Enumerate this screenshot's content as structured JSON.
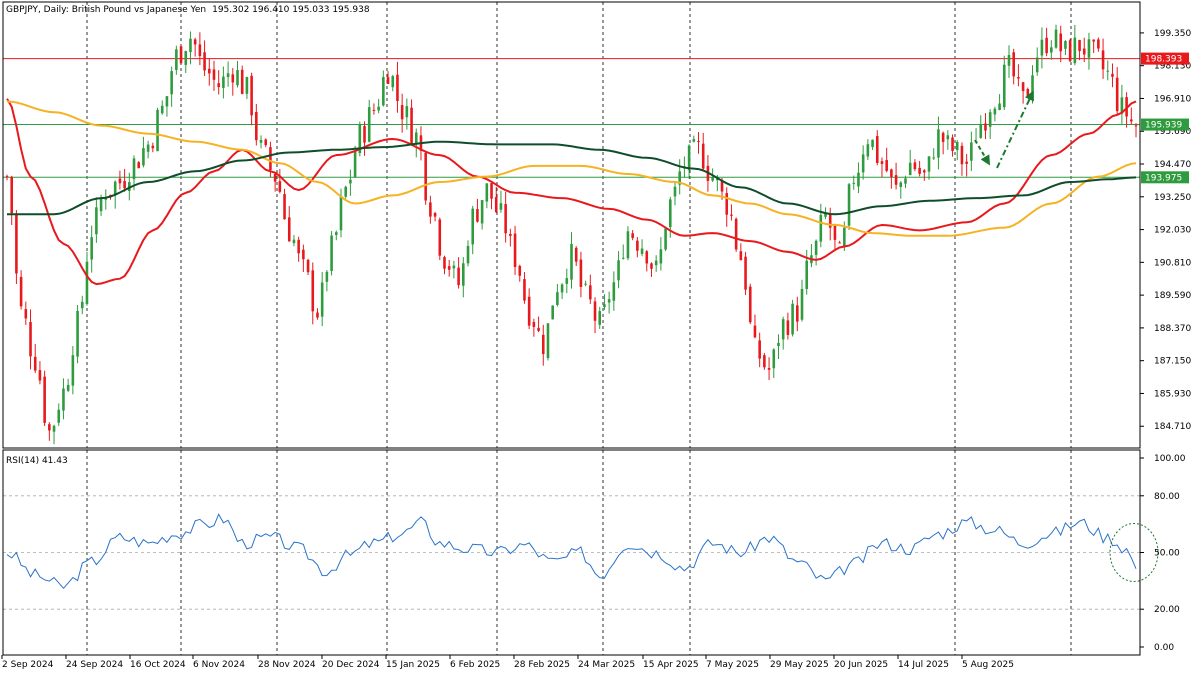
{
  "chart_data": {
    "type": "candlestick",
    "title": "GBPJPY, Daily:  British Pound vs Japanese Yen",
    "ohlc": "195.302 196.410 195.033 195.938",
    "price_axis": {
      "ylim": [
        183.9,
        200.5
      ],
      "ticks": [
        "199.350",
        "198.130",
        "196.910",
        "195.690",
        "194.470",
        "193.250",
        "192.030",
        "190.810",
        "189.590",
        "188.370",
        "187.150",
        "185.930",
        "184.710"
      ]
    },
    "x_ticks": [
      "2 Sep 2024",
      "24 Sep 2024",
      "16 Oct 2024",
      "6 Nov 2024",
      "28 Nov 2024",
      "20 Dec 2024",
      "15 Jan 2025",
      "6 Feb 2025",
      "28 Feb 2025",
      "24 Mar 2025",
      "15 Apr 2025",
      "7 May 2025",
      "29 May 2025",
      "20 Jun 2025",
      "14 Jul 2025",
      "5 Aug 2025"
    ],
    "price_tags": [
      {
        "value": "198.393",
        "color": "#e8191d"
      },
      {
        "value": "195.939",
        "color": "#2e9b3e"
      },
      {
        "value": "193.975",
        "color": "#2e9b3e"
      }
    ],
    "horizontal_levels": [
      {
        "value": 198.393,
        "color": "#e8191d"
      },
      {
        "value": 195.939,
        "color": "#2e9b3e"
      },
      {
        "value": 193.975,
        "color": "#2e9b3e"
      }
    ],
    "close_anchors": [
      [
        0,
        194.0
      ],
      [
        3,
        189.0
      ],
      [
        6,
        187.2
      ],
      [
        9,
        184.5
      ],
      [
        12,
        186.0
      ],
      [
        15,
        188.5
      ],
      [
        18,
        192.0
      ],
      [
        21,
        193.5
      ],
      [
        24,
        193.8
      ],
      [
        27,
        194.5
      ],
      [
        30,
        195.2
      ],
      [
        33,
        196.5
      ],
      [
        36,
        198.5
      ],
      [
        39,
        199.2
      ],
      [
        42,
        198.0
      ],
      [
        45,
        197.4
      ],
      [
        48,
        198.0
      ],
      [
        51,
        197.2
      ],
      [
        54,
        195.0
      ],
      [
        57,
        194.0
      ],
      [
        60,
        192.0
      ],
      [
        63,
        190.5
      ],
      [
        66,
        189.0
      ],
      [
        69,
        191.3
      ],
      [
        72,
        193.5
      ],
      [
        75,
        195.5
      ],
      [
        78,
        196.5
      ],
      [
        81,
        198.0
      ],
      [
        84,
        196.5
      ],
      [
        87,
        195.5
      ],
      [
        90,
        193.0
      ],
      [
        93,
        191.0
      ],
      [
        96,
        190.0
      ],
      [
        99,
        192.5
      ],
      [
        102,
        193.5
      ],
      [
        105,
        192.5
      ],
      [
        108,
        191.0
      ],
      [
        111,
        189.0
      ],
      [
        114,
        187.8
      ],
      [
        117,
        190.0
      ],
      [
        120,
        191.0
      ],
      [
        123,
        189.5
      ],
      [
        126,
        188.5
      ],
      [
        129,
        190.0
      ],
      [
        132,
        192.0
      ],
      [
        135,
        191.5
      ],
      [
        138,
        190.5
      ],
      [
        141,
        193.0
      ],
      [
        144,
        194.5
      ],
      [
        147,
        195.0
      ],
      [
        150,
        194.0
      ],
      [
        153,
        193.0
      ],
      [
        156,
        191.0
      ],
      [
        159,
        187.5
      ],
      [
        162,
        186.8
      ],
      [
        165,
        188.5
      ],
      [
        168,
        189.0
      ],
      [
        171,
        191.0
      ],
      [
        174,
        192.5
      ],
      [
        177,
        191.0
      ],
      [
        180,
        194.0
      ],
      [
        183,
        195.5
      ],
      [
        186,
        194.5
      ],
      [
        189,
        193.5
      ],
      [
        192,
        194.5
      ],
      [
        195,
        194.0
      ],
      [
        198,
        195.5
      ],
      [
        201,
        195.0
      ],
      [
        204,
        194.5
      ],
      [
        207,
        196.0
      ],
      [
        210,
        197.0
      ],
      [
        213,
        198.0
      ],
      [
        216,
        196.8
      ],
      [
        219,
        198.6
      ],
      [
        222,
        199.2
      ],
      [
        225,
        198.6
      ],
      [
        228,
        198.9
      ],
      [
        231,
        198.5
      ],
      [
        234,
        197.8
      ],
      [
        237,
        196.5
      ],
      [
        240,
        195.9
      ]
    ],
    "series": [
      {
        "color": "#e8191d",
        "anchors": [
          [
            0,
            196.9
          ],
          [
            5,
            194.0
          ],
          [
            12,
            191.5
          ],
          [
            19,
            190.0
          ],
          [
            24,
            190.2
          ],
          [
            31,
            192.0
          ],
          [
            38,
            193.4
          ],
          [
            44,
            194.2
          ],
          [
            50,
            195.0
          ],
          [
            56,
            194.2
          ],
          [
            62,
            193.5
          ],
          [
            70,
            194.8
          ],
          [
            82,
            195.4
          ],
          [
            92,
            194.8
          ],
          [
            100,
            194.0
          ],
          [
            108,
            193.4
          ],
          [
            118,
            193.2
          ],
          [
            128,
            192.8
          ],
          [
            136,
            192.4
          ],
          [
            144,
            191.8
          ],
          [
            150,
            191.9
          ],
          [
            158,
            191.6
          ],
          [
            166,
            191.2
          ],
          [
            172,
            190.9
          ],
          [
            178,
            191.4
          ],
          [
            186,
            192.2
          ],
          [
            194,
            192.0
          ],
          [
            204,
            192.3
          ],
          [
            212,
            193.0
          ],
          [
            222,
            194.8
          ],
          [
            230,
            195.6
          ],
          [
            236,
            196.3
          ],
          [
            240,
            196.8
          ]
        ]
      },
      {
        "color": "#f5b324",
        "anchors": [
          [
            0,
            196.8
          ],
          [
            10,
            196.4
          ],
          [
            20,
            195.9
          ],
          [
            30,
            195.6
          ],
          [
            40,
            195.3
          ],
          [
            50,
            195.0
          ],
          [
            58,
            194.5
          ],
          [
            66,
            193.8
          ],
          [
            74,
            193.0
          ],
          [
            82,
            193.3
          ],
          [
            92,
            193.8
          ],
          [
            102,
            194.0
          ],
          [
            112,
            194.4
          ],
          [
            122,
            194.4
          ],
          [
            132,
            194.1
          ],
          [
            142,
            193.8
          ],
          [
            150,
            193.3
          ],
          [
            158,
            193.0
          ],
          [
            166,
            192.6
          ],
          [
            176,
            192.2
          ],
          [
            184,
            191.9
          ],
          [
            192,
            191.8
          ],
          [
            200,
            191.8
          ],
          [
            212,
            192.1
          ],
          [
            222,
            193.0
          ],
          [
            232,
            194.0
          ],
          [
            240,
            194.5
          ]
        ]
      },
      {
        "color": "#0f4e2a",
        "anchors": [
          [
            0,
            192.6
          ],
          [
            10,
            192.6
          ],
          [
            20,
            193.2
          ],
          [
            30,
            193.8
          ],
          [
            40,
            194.2
          ],
          [
            50,
            194.6
          ],
          [
            60,
            194.9
          ],
          [
            70,
            195.0
          ],
          [
            80,
            195.1
          ],
          [
            92,
            195.3
          ],
          [
            104,
            195.2
          ],
          [
            116,
            195.2
          ],
          [
            126,
            195.0
          ],
          [
            136,
            194.7
          ],
          [
            146,
            194.3
          ],
          [
            156,
            193.6
          ],
          [
            166,
            193.0
          ],
          [
            176,
            192.6
          ],
          [
            186,
            192.9
          ],
          [
            196,
            193.1
          ],
          [
            206,
            193.2
          ],
          [
            216,
            193.3
          ],
          [
            226,
            193.8
          ],
          [
            234,
            193.9
          ],
          [
            240,
            193.97
          ]
        ]
      }
    ],
    "annotation": {
      "type": "arrows",
      "color": "#1b7a2f"
    },
    "rsi": {
      "title": "RSI(14) 41.43",
      "ylim": [
        0,
        100
      ],
      "ticks": [
        "100.00",
        "80.00",
        "50.00",
        "20.00",
        "0.00"
      ],
      "levels": [
        80,
        50,
        20
      ],
      "color": "#2a73c9",
      "anchors": [
        [
          0,
          50
        ],
        [
          6,
          38
        ],
        [
          12,
          32
        ],
        [
          18,
          45
        ],
        [
          24,
          58
        ],
        [
          30,
          55
        ],
        [
          36,
          60
        ],
        [
          42,
          65
        ],
        [
          46,
          68
        ],
        [
          50,
          55
        ],
        [
          56,
          58
        ],
        [
          62,
          52
        ],
        [
          68,
          40
        ],
        [
          72,
          48
        ],
        [
          78,
          55
        ],
        [
          84,
          60
        ],
        [
          88,
          66
        ],
        [
          92,
          55
        ],
        [
          98,
          52
        ],
        [
          104,
          50
        ],
        [
          110,
          54
        ],
        [
          116,
          45
        ],
        [
          122,
          50
        ],
        [
          126,
          38
        ],
        [
          132,
          55
        ],
        [
          138,
          50
        ],
        [
          144,
          42
        ],
        [
          150,
          55
        ],
        [
          156,
          50
        ],
        [
          162,
          58
        ],
        [
          168,
          45
        ],
        [
          174,
          35
        ],
        [
          180,
          44
        ],
        [
          186,
          55
        ],
        [
          192,
          52
        ],
        [
          198,
          60
        ],
        [
          204,
          66
        ],
        [
          210,
          62
        ],
        [
          216,
          55
        ],
        [
          222,
          60
        ],
        [
          228,
          66
        ],
        [
          234,
          58
        ],
        [
          238,
          52
        ],
        [
          240,
          41.43
        ]
      ],
      "circle": {
        "x_index": 240,
        "value": 50
      }
    }
  }
}
